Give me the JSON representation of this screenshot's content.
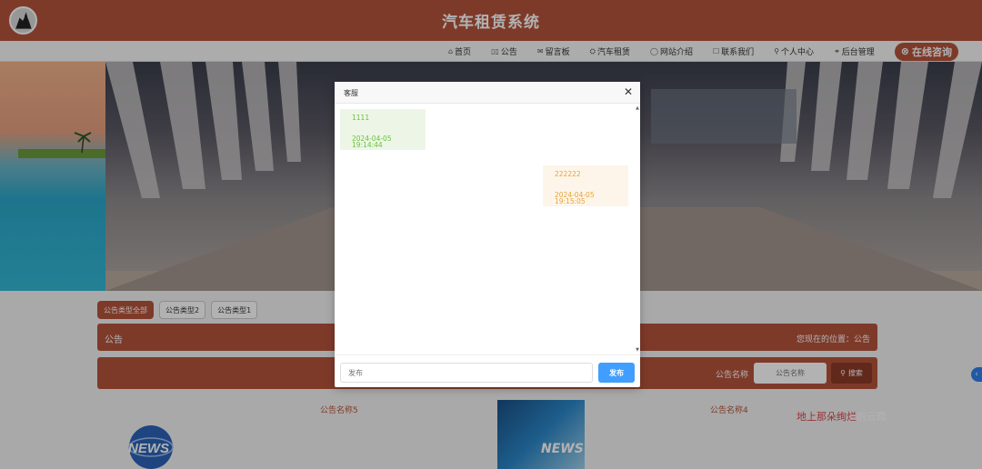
{
  "header": {
    "title": "汽车租赁系统"
  },
  "nav": {
    "items": [
      {
        "label": "首页",
        "icon": "home-icon",
        "glyph": "⌂"
      },
      {
        "label": "公告",
        "icon": "notice-icon",
        "glyph": "▯▯"
      },
      {
        "label": "留言板",
        "icon": "message-board-icon",
        "glyph": "✉"
      },
      {
        "label": "汽车租赁",
        "icon": "car-icon",
        "glyph": "⛭"
      },
      {
        "label": "网站介绍",
        "icon": "info-icon",
        "glyph": "◯"
      },
      {
        "label": "联系我们",
        "icon": "contact-icon",
        "glyph": "☐"
      },
      {
        "label": "个人中心",
        "icon": "user-icon",
        "glyph": "⚲"
      },
      {
        "label": "后台管理",
        "icon": "link-icon",
        "glyph": "⚭"
      }
    ],
    "consult": {
      "label": "在线咨询",
      "icon": "consult-icon",
      "glyph": "⊗"
    }
  },
  "tabs": [
    "公告类型全部",
    "公告类型2",
    "公告类型1"
  ],
  "section": {
    "title": "公告",
    "breadcrumb": "您现在的位置：公告"
  },
  "search": {
    "label": "公告名称",
    "placeholder": "公告名称",
    "button": "搜索"
  },
  "news": {
    "item1_title": "公告名称5",
    "item2_title": "公告名称4",
    "thumb_text": "NEWS"
  },
  "watermark": {
    "red_part": "地上那朵绚烂",
    "white_part": "的云霞"
  },
  "dialog": {
    "title": "客服",
    "messages": [
      {
        "side": "left",
        "text": "1111",
        "time": "2024-04-05 19:14:44"
      },
      {
        "side": "right",
        "text": "222222",
        "time": "2024-04-05 19:15:05"
      }
    ],
    "input_placeholder": "发布",
    "send_label": "发布"
  },
  "colors": {
    "primary": "#b5533b",
    "send": "#409eff",
    "left_msg": "#67c23a",
    "right_msg": "#e6a23c"
  }
}
